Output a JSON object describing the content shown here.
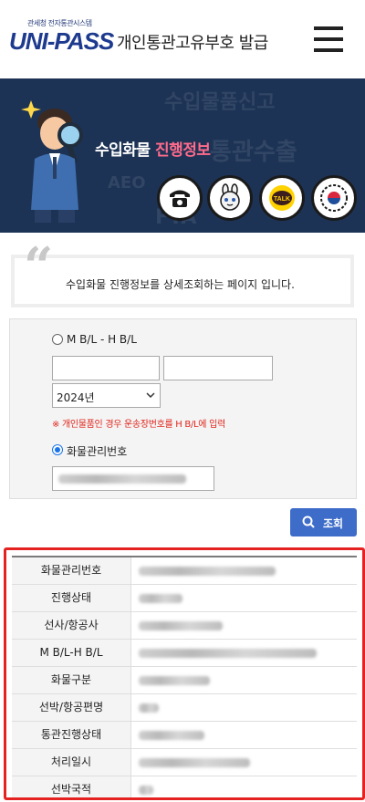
{
  "header": {
    "logo_subtitle": "관세청 전자통관시스템",
    "logo_text": "UNI-PASS",
    "site_title": "개인통관고유부호 발급",
    "menu_icon": "hamburger-menu-icon"
  },
  "banner": {
    "title_main": "수입화물",
    "title_highlight": "진행정보",
    "background_words": [
      "수입물품신고",
      "통관수출",
      "AEO",
      "FTA"
    ],
    "icons": [
      "telephone-icon",
      "chatbot-icon",
      "kakaotalk-icon",
      "government-emblem-icon"
    ],
    "talk_label": "TALK",
    "colors": {
      "background": "#1d3355",
      "highlight": "#ff6b8b"
    }
  },
  "info": {
    "text": "수입화물 진행정보를 상세조회하는 페이지 입니다."
  },
  "search_form": {
    "option_mbl_label": "M B/L - H B/L",
    "option_mbl_selected": false,
    "mbl_value": "",
    "hbl_value": "",
    "year_selected": "2024년",
    "note": "※ 개인물품인 경우 운송장번호를 H B/L에 입력",
    "option_cargo_label": "화물관리번호",
    "option_cargo_selected": true,
    "search_button_label": "조회",
    "colors": {
      "note": "#e0251b",
      "button": "#3d6cc9",
      "radio": "#1a73e8"
    }
  },
  "result": {
    "highlight_color": "#e52222",
    "rows": [
      {
        "label": "화물관리번호"
      },
      {
        "label": "진행상태"
      },
      {
        "label": "선사/항공사"
      },
      {
        "label": "M B/L-H B/L"
      },
      {
        "label": "화물구분"
      },
      {
        "label": "선박/항공편명"
      },
      {
        "label": "통관진행상태"
      },
      {
        "label": "처리일시"
      },
      {
        "label": "선박국적"
      }
    ]
  }
}
